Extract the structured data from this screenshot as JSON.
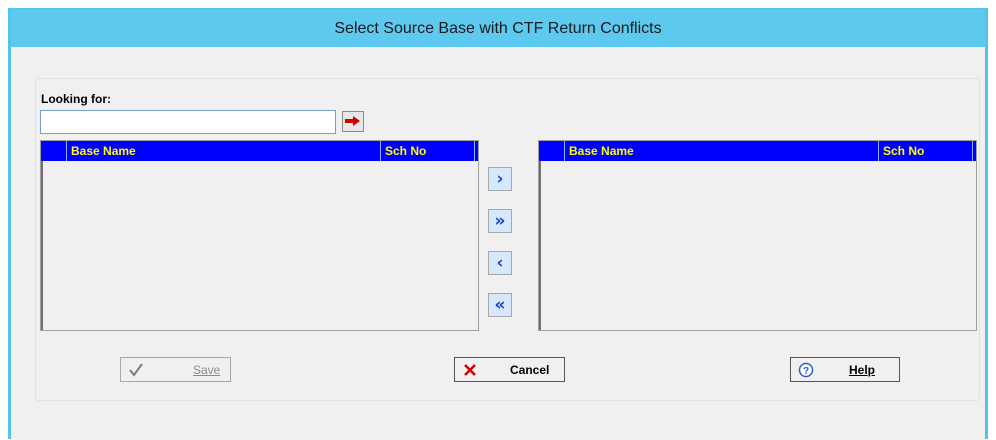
{
  "window": {
    "title": "Select Source Base with CTF Return Conflicts"
  },
  "search": {
    "label": "Looking for:",
    "value": ""
  },
  "left_list": {
    "columns": [
      "Base Name",
      "Sch No"
    ],
    "rows": []
  },
  "right_list": {
    "columns": [
      "Base Name",
      "Sch No"
    ],
    "rows": []
  },
  "move_buttons": {
    "add": "›",
    "add_all": "»",
    "remove": "‹",
    "remove_all": "«"
  },
  "actions": {
    "save": "Save",
    "cancel": "Cancel",
    "help": "Help"
  },
  "colors": {
    "title_bar": "#5ec9ef",
    "list_header": "#0000ff",
    "header_text": "#ffff00",
    "move_arrow": "#1a46c8"
  },
  "icons": {
    "go": "red-arrow-right-icon",
    "save": "checkmark-icon",
    "cancel": "red-x-icon",
    "help": "question-circle-icon"
  }
}
